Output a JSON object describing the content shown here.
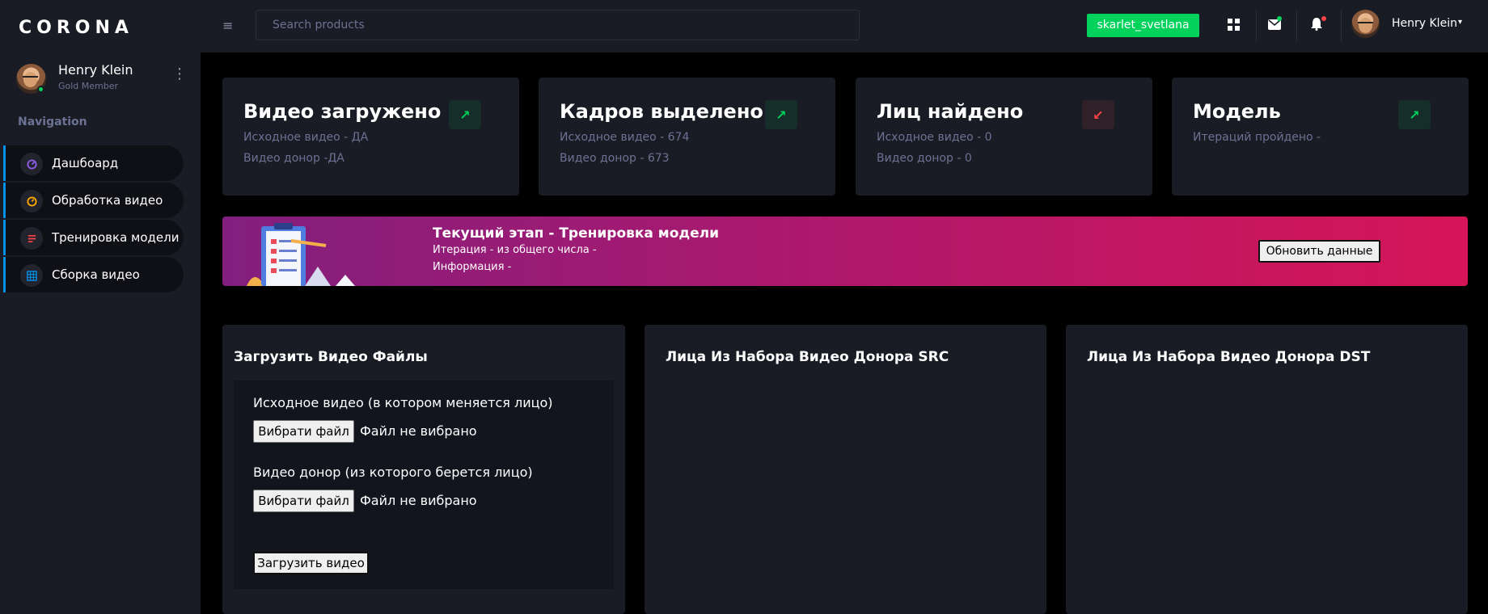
{
  "brand": "CORONA",
  "sidebar": {
    "profile": {
      "name": "Henry Klein",
      "subtitle": "Gold Member"
    },
    "nav_category": "Navigation",
    "items": [
      {
        "label": "Дашбоард",
        "icon": "speedometer-icon",
        "icon_color": "#8f5fe8"
      },
      {
        "label": "Обработка видео",
        "icon": "playlist-play-icon",
        "icon_color": "#ffab00"
      },
      {
        "label": "Тренировка модели",
        "icon": "file-document-icon",
        "icon_color": "#fc424a"
      },
      {
        "label": "Сборка видео",
        "icon": "table-large-icon",
        "icon_color": "#0090e7"
      }
    ]
  },
  "header": {
    "search_placeholder": "Search products",
    "user_button": "skarlet_svetlana",
    "user_name": "Henry Klein"
  },
  "stats": [
    {
      "title": "Видео загружено",
      "lines": [
        "Исходное видео - ДА",
        "Видео донор -ДА"
      ],
      "trend": "up",
      "icon": "arrow-top-right-icon"
    },
    {
      "title": "Кадров выделено",
      "lines": [
        "Исходное видео - 674",
        "Видео донор - 673"
      ],
      "trend": "up",
      "icon": "arrow-top-right-icon"
    },
    {
      "title": "Лиц найдено",
      "lines": [
        "Исходное видео - 0",
        "Видео донор - 0"
      ],
      "trend": "down",
      "icon": "arrow-bottom-left-icon"
    },
    {
      "title": "Модель",
      "lines": [
        "Итераций пройдено -"
      ],
      "trend": "up",
      "icon": "arrow-top-right-icon"
    }
  ],
  "banner": {
    "title": "Текущий этап - Тренировка модели",
    "line1": "Итерация - из общего числа -",
    "line2": "Информация -",
    "button": "Обновить данные"
  },
  "upload_panel": {
    "title": "Загрузить Видео Файлы",
    "source_label": "Исходное видео (в котором меняется лицо)",
    "donor_label": "Видео донор (из которого берется лицо)",
    "file_button": "Вибрати файл",
    "file_status": "Файл не вибрано",
    "submit": "Загрузить видео"
  },
  "src_panel": {
    "title": "Лица Из Набора Видео Донора SRC"
  },
  "dst_panel": {
    "title": "Лица Из Набора Видео Донора DST"
  },
  "colors": {
    "success": "#00d25b",
    "danger": "#fc424a",
    "primary": "#0090e7",
    "sidebar_bg": "#191c24"
  }
}
